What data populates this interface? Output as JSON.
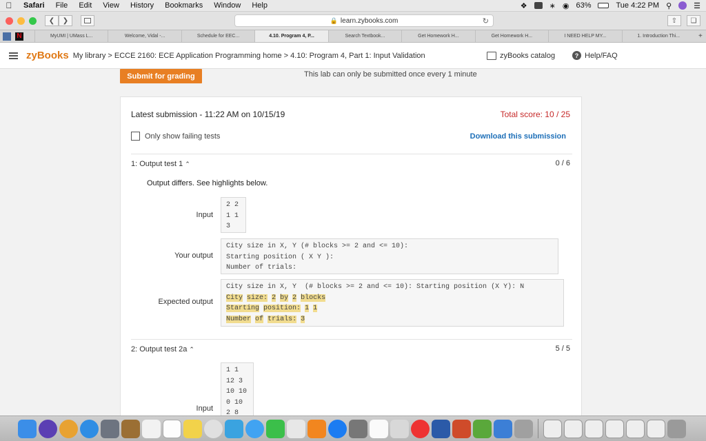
{
  "menubar": {
    "app": "Safari",
    "items": [
      "File",
      "Edit",
      "View",
      "History",
      "Bookmarks",
      "Window",
      "Help"
    ],
    "battery": "63%",
    "clock": "Tue 4:22 PM"
  },
  "browser": {
    "url": "learn.zybooks.com",
    "tabs": [
      "MyUMI | UMass L...",
      "Welcome, Vidal -...",
      "Schedule for EEC...",
      "4.10. Program 4, P...",
      "Search Textbook...",
      "Get Homework H...",
      "Get Homework H...",
      "I NEED HELP MY...",
      "1. Introduction Thi..."
    ],
    "active_tab": 3
  },
  "zybooks": {
    "logo": "zyBooks",
    "breadcrumb": "My library > ECCE 2160: ECE Application Programming home > 4.10: Program 4, Part 1: Input Validation",
    "catalog": "zyBooks catalog",
    "help": "Help/FAQ"
  },
  "lab": {
    "submit_label": "Submit for grading",
    "note": "This lab can only be submitted once every 1 minute",
    "latest": "Latest submission - 11:22 AM on 10/15/19",
    "total": "Total score: 10 / 25",
    "only_failing": "Only show failing tests",
    "download": "Download this submission",
    "accent": "#e87f23",
    "error_color": "#c62828",
    "link_color": "#1d6fb8"
  },
  "tests": [
    {
      "title": "1: Output test 1",
      "score": "0 / 6",
      "message": "Output differs. See highlights below.",
      "input_label": "Input",
      "input": [
        "2 2",
        "1 1",
        "3"
      ],
      "your_label": "Your output",
      "your_output": [
        "City size in X, Y (# blocks >= 2 and <= 10):",
        "Starting position ( X Y ):",
        "Number of trials:"
      ],
      "expected_label": "Expected output",
      "expected_first": "City size in X, Y  (# blocks >= 2 and <= 10): Starting position (X Y): N",
      "expected_hl": [
        [
          "City",
          "size:",
          "2",
          "by",
          "2",
          "blocks"
        ],
        [
          "Starting",
          "position:",
          "1",
          "1"
        ],
        [
          "Number",
          "of",
          "trials:",
          "3"
        ]
      ]
    },
    {
      "title": "2: Output test 2a",
      "score": "5 / 5",
      "input_label": "Input",
      "input": [
        "1 1",
        "12 3",
        "10 10",
        "0 10",
        "2 8"
      ]
    }
  ],
  "icons": {
    "apple": "apple-logo-icon",
    "chevron": "chevron-up-icon",
    "book": "book-icon",
    "help": "question-icon"
  }
}
